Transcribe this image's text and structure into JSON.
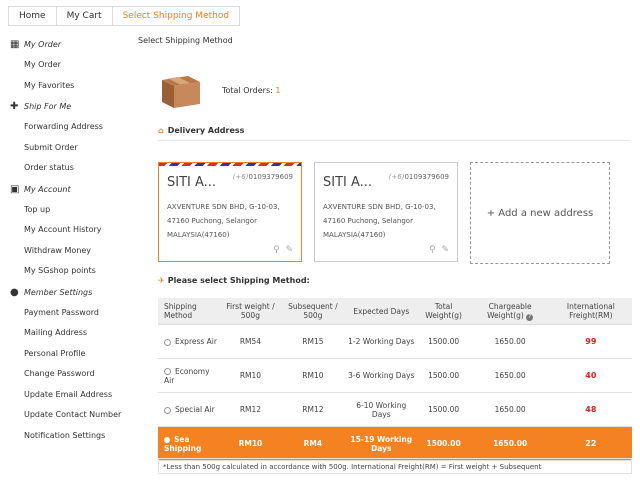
{
  "breadcrumb": [
    "Home",
    "My Cart",
    "Select Shipping Method"
  ],
  "sidebar": [
    {
      "title": "My Order",
      "icon": "grid-icon",
      "items": [
        "My Order",
        "My Favorites"
      ]
    },
    {
      "title": "Ship For Me",
      "icon": "plus-icon",
      "items": [
        "Forwarding Address",
        "Submit Order",
        "Order status"
      ]
    },
    {
      "title": "My Account",
      "icon": "card-icon",
      "items": [
        "Top up",
        "My Account History",
        "Withdraw Money",
        "My SGshop points"
      ]
    },
    {
      "title": "Member Settings",
      "icon": "user-icon",
      "items": [
        "Payment Password",
        "Mailing Address",
        "Personal Profile",
        "Change Password",
        "Update Email Address",
        "Update Contact Number",
        "Notification Settings"
      ]
    }
  ],
  "main": {
    "page_title": "Select Shipping Method",
    "total_label": "Total Orders:",
    "total_value": "1",
    "delivery_title": "Delivery Address",
    "shipping_title": "Please select Shipping Method:",
    "add_new": "+ Add a new address",
    "note": "*Less than 500g calculated in accordance with 500g. International Freight(RM) = First weight + Subsequent"
  },
  "addresses": [
    {
      "name": "SITI A...",
      "prefix": "(+6)",
      "phone": "0109379609",
      "line1": "AXVENTURE SDN BHD, G-10-03,",
      "line2": "47160 Puchong, Selangor",
      "line3": "MALAYSIA(47160)"
    },
    {
      "name": "SITI A...",
      "prefix": "(+6)",
      "phone": "0109379609",
      "line1": "AXVENTURE SDN BHD, G-10-03,",
      "line2": "47160 Puchong, Selangor",
      "line3": "MALAYSIA(47160)"
    }
  ],
  "table": {
    "headers": [
      "Shipping Method",
      "First weight / 500g",
      "Subsequent / 500g",
      "Expected Days",
      "Total Weight(g)",
      "Chargeable Weight(g)",
      "International Freight(RM)"
    ],
    "rows": [
      [
        "Express Air",
        "RM54",
        "RM15",
        "1-2 Working Days",
        "1500.00",
        "1650.00",
        "99"
      ],
      [
        "Economy Air",
        "RM10",
        "RM10",
        "3-6 Working Days",
        "1500.00",
        "1650.00",
        "40"
      ],
      [
        "Special Air",
        "RM12",
        "RM12",
        "6-10 Working Days",
        "1500.00",
        "1650.00",
        "48"
      ],
      [
        "Sea Shipping",
        "RM10",
        "RM4",
        "15-19 Working Days",
        "1500.00",
        "1650.00",
        "22"
      ]
    ]
  },
  "colors": {
    "accent": "#f58220",
    "freight": "#e02020"
  }
}
